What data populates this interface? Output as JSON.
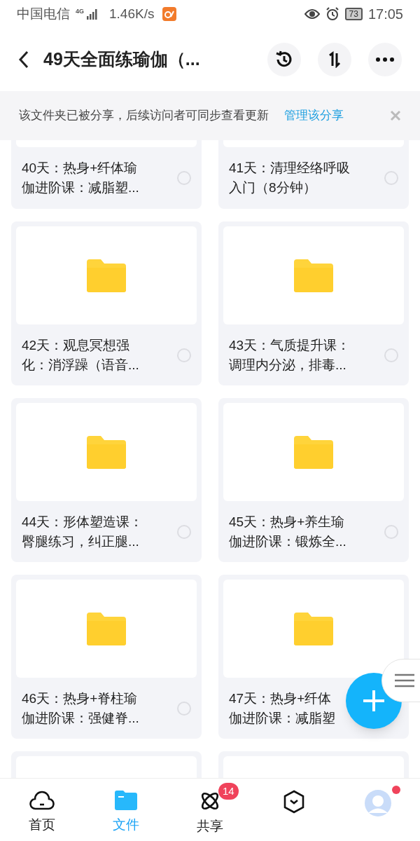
{
  "status_bar": {
    "carrier": "中国电信",
    "network": "4G",
    "speed": "1.46K/s",
    "battery": "73",
    "time": "17:05"
  },
  "header": {
    "title": "49天全面练瑜伽（..."
  },
  "share_banner": {
    "text": "该文件夹已被分享，后续访问者可同步查看更新",
    "link": "管理该分享"
  },
  "folders": [
    {
      "kind": "folder",
      "cut": true,
      "title": [
        "40天：热身+纤体瑜",
        "伽进阶课：减脂塑..."
      ],
      "selected": false
    },
    {
      "kind": "folder",
      "cut": true,
      "title": [
        "41天：清理经络呼吸",
        "入门（8分钟）"
      ],
      "selected": false
    },
    {
      "kind": "folder",
      "title": [
        "42天：观息冥想强",
        "化：消浮躁（语音..."
      ],
      "selected": false
    },
    {
      "kind": "folder",
      "title": [
        "43天：气质提升课：",
        "调理内分泌，排毒..."
      ],
      "selected": false
    },
    {
      "kind": "folder",
      "title": [
        "44天：形体塑造课：",
        "臀腿练习，纠正腿..."
      ],
      "selected": false
    },
    {
      "kind": "folder",
      "title": [
        "45天：热身+养生瑜",
        "伽进阶课：锻炼全..."
      ],
      "selected": false
    },
    {
      "kind": "folder",
      "title": [
        "46天：热身+脊柱瑜",
        "伽进阶课：强健脊..."
      ],
      "selected": false
    },
    {
      "kind": "folder",
      "title": [
        "47天：热身+纤体",
        "伽进阶课：减脂塑"
      ]
    },
    {
      "kind": "folder"
    },
    {
      "kind": "folder"
    }
  ],
  "nav": [
    {
      "label": "首页",
      "kind": "cloud",
      "selected": false
    },
    {
      "label": "文件",
      "kind": "folder",
      "selected": true
    },
    {
      "label": "共享",
      "kind": "atom",
      "selected": false,
      "badge": "14"
    },
    {
      "kind": "hexagon",
      "selected": false
    },
    {
      "kind": "avatar",
      "selected": false,
      "dot": true
    }
  ]
}
